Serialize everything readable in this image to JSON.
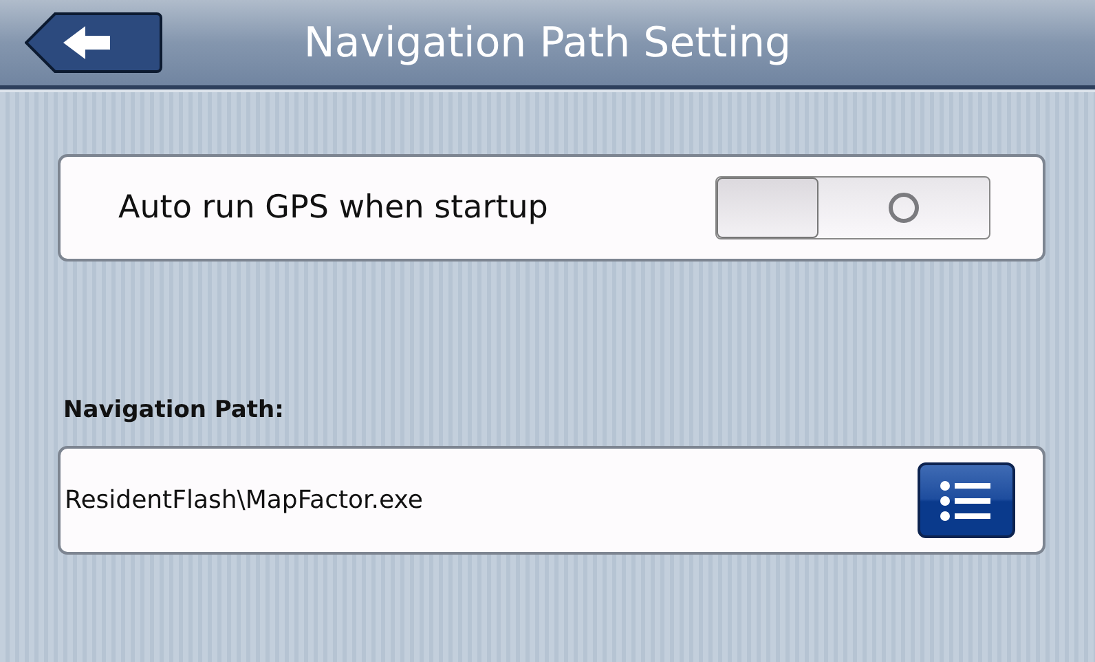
{
  "header": {
    "title": "Navigation Path Setting"
  },
  "autorun": {
    "label": "Auto run GPS when startup",
    "on": false
  },
  "path": {
    "label": "Navigation Path:",
    "value": "ResidentFlash\\MapFactor.exe"
  }
}
